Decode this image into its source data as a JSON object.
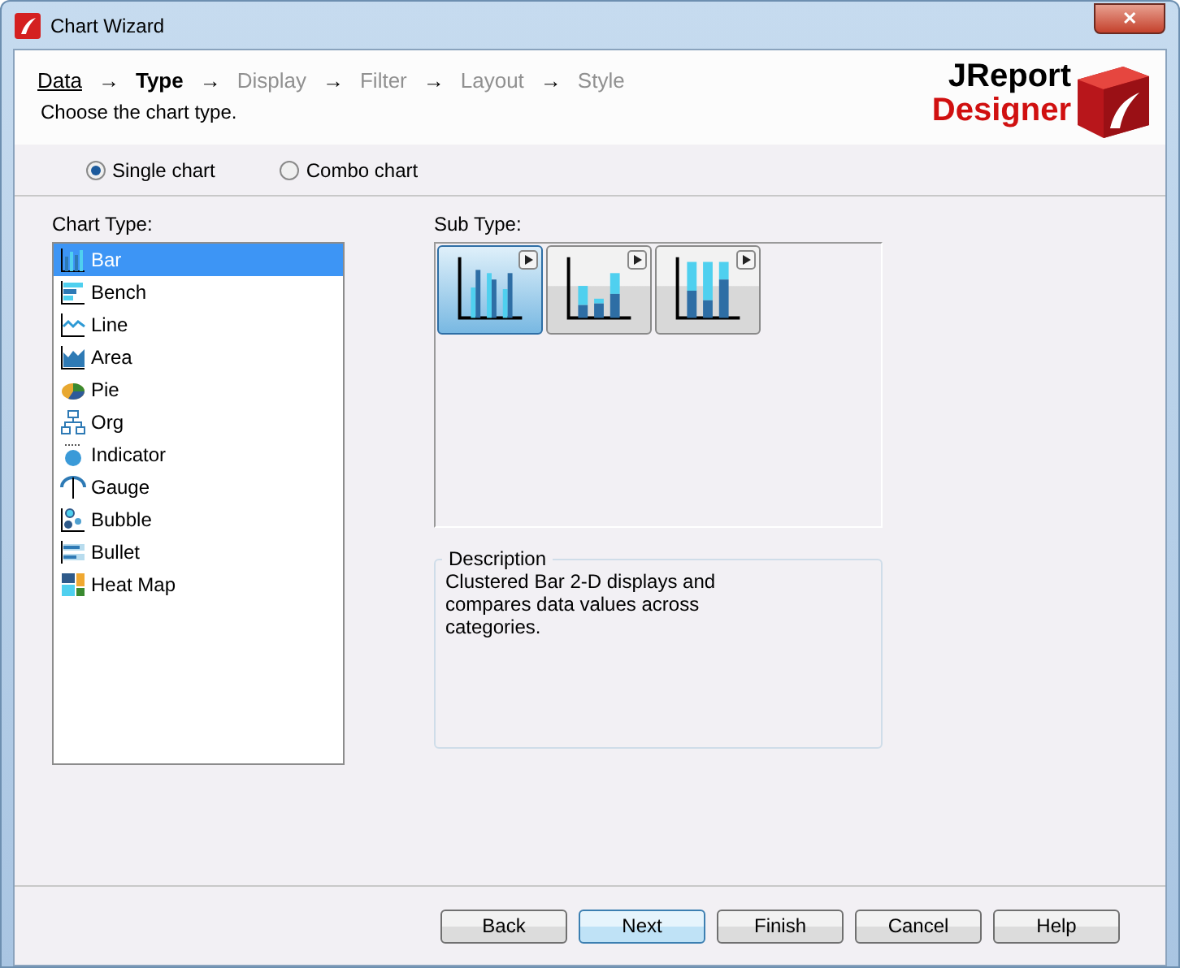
{
  "window": {
    "title": "Chart Wizard",
    "close": "✕"
  },
  "steps": [
    {
      "label": "Data",
      "visited": true,
      "current": false
    },
    {
      "arrow": "→",
      "label": "Type",
      "visited": false,
      "current": true
    },
    {
      "arrow": "→",
      "label": "Display",
      "visited": false,
      "current": false
    },
    {
      "arrow": "→",
      "label": "Filter",
      "visited": false,
      "current": false
    },
    {
      "arrow": "→",
      "label": "Layout",
      "visited": false,
      "current": false
    },
    {
      "arrow": "→",
      "label": "Style",
      "visited": false,
      "current": false
    }
  ],
  "instruction": "Choose the chart type.",
  "logo": {
    "line_1": "JReport",
    "line_2": "Designer"
  },
  "modes": [
    {
      "label": "Single chart",
      "selected": true
    },
    {
      "label": "Combo chart",
      "selected": false
    }
  ],
  "chart_type": {
    "label": "Chart Type:",
    "items": [
      {
        "kind": "bar",
        "label": "Bar",
        "selected": true
      },
      {
        "kind": "bench",
        "label": "Bench",
        "selected": false
      },
      {
        "kind": "line",
        "label": "Line",
        "selected": false
      },
      {
        "kind": "area",
        "label": "Area",
        "selected": false
      },
      {
        "kind": "pie",
        "label": "Pie",
        "selected": false
      },
      {
        "kind": "org",
        "label": "Org",
        "selected": false
      },
      {
        "kind": "indicator",
        "label": "Indicator",
        "selected": false
      },
      {
        "kind": "gauge",
        "label": "Gauge",
        "selected": false
      },
      {
        "kind": "bubble",
        "label": "Bubble",
        "selected": false
      },
      {
        "kind": "bullet",
        "label": "Bullet",
        "selected": false
      },
      {
        "kind": "heatmap",
        "label": "Heat Map",
        "selected": false
      }
    ]
  },
  "sub_type": {
    "label": "Sub Type:",
    "items": [
      {
        "kind": "clustered",
        "selected": true
      },
      {
        "kind": "stacked",
        "selected": false
      },
      {
        "kind": "stacked100",
        "selected": false
      }
    ]
  },
  "description": {
    "label": "Description",
    "text": "Clustered Bar 2-D displays and compares data values across categories."
  },
  "buttons": [
    {
      "label": "Back",
      "default": false
    },
    {
      "label": "Next",
      "default": true
    },
    {
      "label": "Finish",
      "default": false
    },
    {
      "label": "Cancel",
      "default": false
    },
    {
      "label": "Help",
      "default": false
    }
  ]
}
